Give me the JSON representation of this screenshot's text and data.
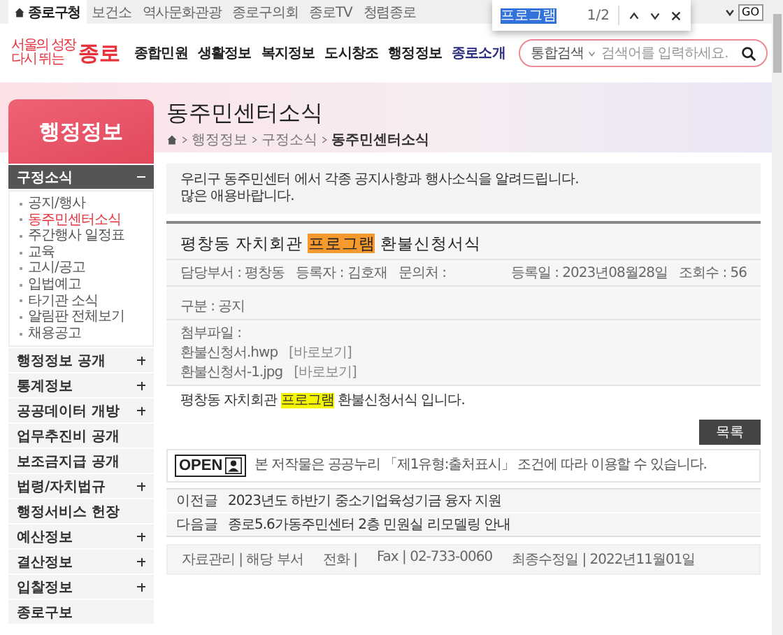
{
  "top_bar": {
    "tabs": [
      {
        "label": "종로구청",
        "selected": true
      },
      {
        "label": "보건소",
        "selected": false
      },
      {
        "label": "역사문화관광",
        "selected": false
      },
      {
        "label": "종로구의회",
        "selected": false
      },
      {
        "label": "종로TV",
        "selected": false
      },
      {
        "label": "청렴종로",
        "selected": false
      }
    ],
    "go_button": "GO"
  },
  "find_bar": {
    "query": "프로그램",
    "count": "1/2"
  },
  "header": {
    "logo": {
      "line_1": "서울의 성장",
      "line_2": "다시 뛰는",
      "name": "종로"
    },
    "nav": [
      {
        "label": "종합민원",
        "selected": false
      },
      {
        "label": "생활정보",
        "selected": false
      },
      {
        "label": "복지정보",
        "selected": false
      },
      {
        "label": "도시창조",
        "selected": false
      },
      {
        "label": "행정정보",
        "selected": false
      },
      {
        "label": "종로소개",
        "selected": true
      }
    ],
    "search": {
      "scope": "통합검색",
      "placeholder": "검색어를 입력하세요."
    }
  },
  "sidebar": {
    "title": "행정정보",
    "sections": [
      {
        "label": "구정소식",
        "expandable": true,
        "expanded": true,
        "children": [
          {
            "label": "공지/행사",
            "selected": false
          },
          {
            "label": "동주민센터소식",
            "selected": true
          },
          {
            "label": "주간행사 일정표",
            "selected": false
          },
          {
            "label": "교육",
            "selected": false
          },
          {
            "label": "고시/공고",
            "selected": false
          },
          {
            "label": "입법예고",
            "selected": false
          },
          {
            "label": "타기관 소식",
            "selected": false
          },
          {
            "label": "알림판 전체보기",
            "selected": false
          },
          {
            "label": "채용공고",
            "selected": false
          }
        ]
      },
      {
        "label": "행정정보 공개",
        "expandable": true,
        "expanded": false
      },
      {
        "label": "통계정보",
        "expandable": true,
        "expanded": false
      },
      {
        "label": "공공데이터 개방",
        "expandable": true,
        "expanded": false
      },
      {
        "label": "업무추진비 공개",
        "expandable": false,
        "expanded": false
      },
      {
        "label": "보조금지급 공개",
        "expandable": false,
        "expanded": false
      },
      {
        "label": "법령/자치법규",
        "expandable": true,
        "expanded": false
      },
      {
        "label": "행정서비스 헌장",
        "expandable": false,
        "expanded": false
      },
      {
        "label": "예산정보",
        "expandable": true,
        "expanded": false
      },
      {
        "label": "결산정보",
        "expandable": true,
        "expanded": false
      },
      {
        "label": "입찰정보",
        "expandable": true,
        "expanded": false
      },
      {
        "label": "종로구보",
        "expandable": false,
        "expanded": false
      }
    ]
  },
  "page": {
    "title": "동주민센터소식",
    "breadcrumb": [
      "행정정보",
      "구정소식",
      "동주민센터소식"
    ],
    "intro": "우리구 동주민센터 에서 각종 공지사항과 행사소식을 알려드립니다.\n많은 애용바랍니다.",
    "post": {
      "title": [
        {
          "kind": "text",
          "text": "평창동 자치회관 "
        },
        {
          "kind": "current-match",
          "text": "프로그램"
        },
        {
          "kind": "text",
          "text": " 환불신청서식"
        }
      ],
      "meta_left": [
        "담당부서 : 평창동",
        "등록자 : 김호재",
        "문의처 :"
      ],
      "meta_right": [
        "등록일 : 2023년08월28일",
        "조회수 : 56"
      ],
      "category": "구분 : 공지",
      "attachments_label": "첨부파일 :",
      "attachments": [
        {
          "file": "환불신청서.hwp",
          "view": "[바로보기]"
        },
        {
          "file": "환불신청서-1.jpg",
          "view": "[바로보기]"
        }
      ],
      "body": [
        {
          "kind": "text",
          "text": "평창동 자치회관 "
        },
        {
          "kind": "match",
          "text": "프로그램"
        },
        {
          "kind": "text",
          "text": " 환불신청서식 입니다."
        }
      ]
    },
    "list_button": "목록",
    "license": {
      "logo": "OPEN",
      "text": "본 저작물은 공공누리 「제1유형:출처표시」 조건에 따라 이용할 수 있습니다."
    },
    "adjacent": [
      {
        "label": "이전글",
        "title": "2023년도 하반기 중소기업육성기금 융자 지원"
      },
      {
        "label": "다음글",
        "title": "종로5.6가동주민센터 2층 민원실 리모델링 안내"
      }
    ],
    "footer": [
      "자료관리 | 해당 부서",
      "전화 |",
      "Fax | 02-733-0060",
      "최종수정일 | 2022년11월01일"
    ]
  }
}
